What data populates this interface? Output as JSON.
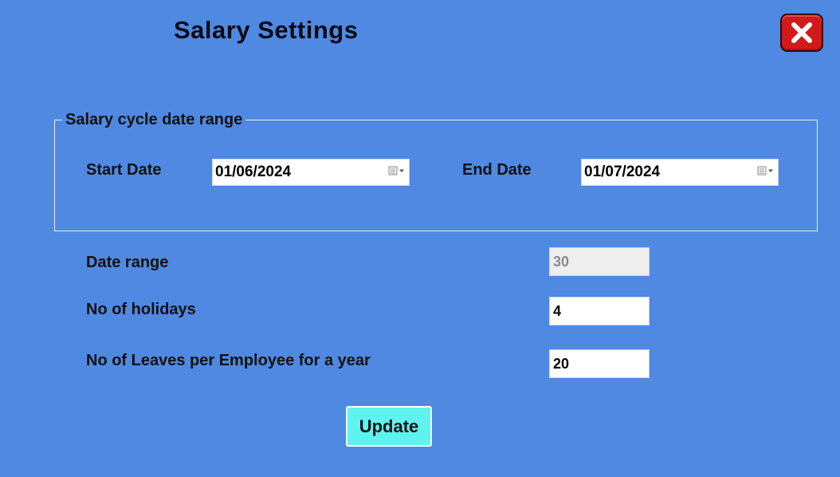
{
  "dialog": {
    "title": "Salary Settings",
    "close_icon": "close-x-icon"
  },
  "salary_cycle": {
    "legend": "Salary cycle date range",
    "start_date": {
      "label": "Start Date",
      "value": "01/06/2024",
      "icon": "calendar-dropdown-icon"
    },
    "end_date": {
      "label": "End Date",
      "value": "01/07/2024",
      "icon": "calendar-dropdown-icon"
    }
  },
  "fields": {
    "date_range": {
      "label": "Date range",
      "value": "30"
    },
    "holidays": {
      "label": "No of holidays",
      "value": "4"
    },
    "leaves": {
      "label": "No of Leaves per Employee for a year",
      "value": "20"
    }
  },
  "actions": {
    "update_label": "Update"
  },
  "colors": {
    "background": "#4f89e1",
    "close_button": "#d21a1a",
    "update_button": "#5ff3ef"
  }
}
